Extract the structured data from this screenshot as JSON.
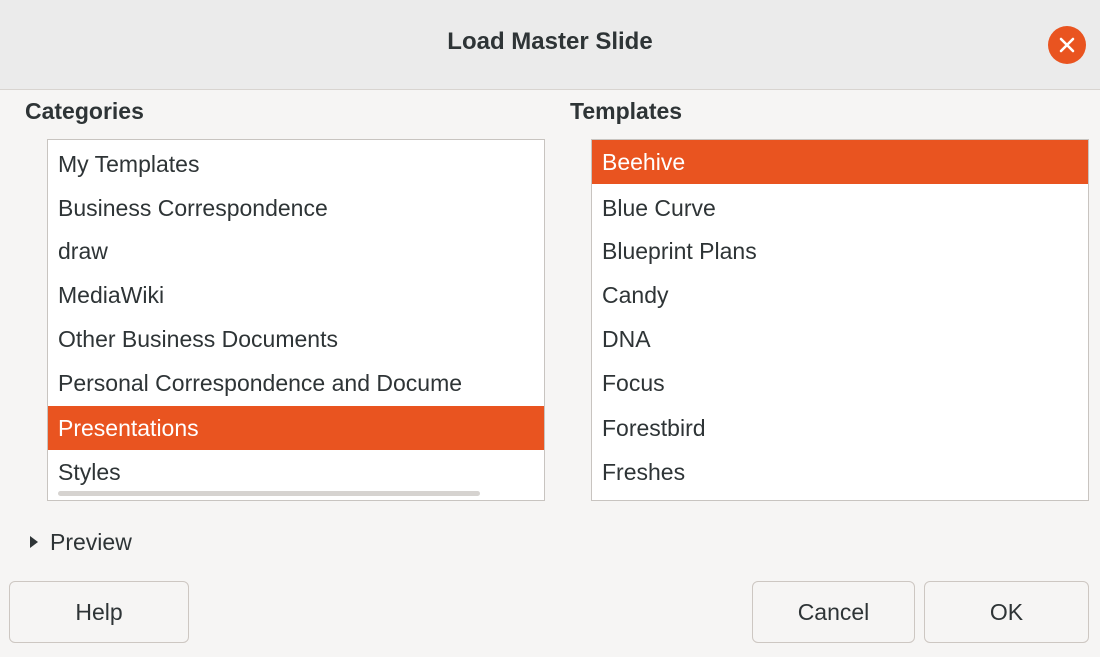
{
  "dialog": {
    "title": "Load Master Slide"
  },
  "categories": {
    "label": "Categories",
    "selected_index": 6,
    "items": [
      "My Templates",
      "Business Correspondence",
      "draw",
      "MediaWiki",
      "Other Business Documents",
      "Personal Correspondence and Docume",
      "Presentations",
      "Styles"
    ]
  },
  "templates": {
    "label": "Templates",
    "selected_index": 0,
    "items": [
      "Beehive",
      "Blue Curve",
      "Blueprint Plans",
      "Candy",
      "DNA",
      "Focus",
      "Forestbird",
      "Freshes"
    ]
  },
  "preview": {
    "label": "Preview"
  },
  "buttons": {
    "help": "Help",
    "cancel": "Cancel",
    "ok": "OK"
  },
  "colors": {
    "accent": "#e95420"
  },
  "icons": {
    "close": "close-icon",
    "expander": "expander-triangle-icon"
  }
}
